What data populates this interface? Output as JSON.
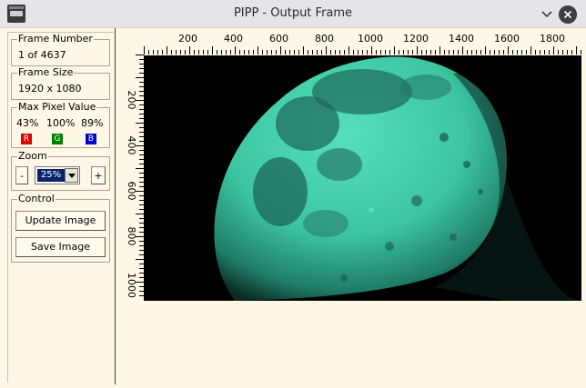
{
  "window": {
    "title": "PIPP - Output Frame"
  },
  "frame_number": {
    "label": "Frame Number",
    "value": "1 of 4637"
  },
  "frame_size": {
    "label": "Frame Size",
    "value": "1920 x 1080"
  },
  "max_pixel": {
    "label": "Max Pixel Value",
    "r_value": "43%",
    "g_value": "100%",
    "b_value": "89%",
    "r_label": "R",
    "g_label": "G",
    "b_label": "B",
    "r_color": "#e00000",
    "g_color": "#008000",
    "b_color": "#0000d0"
  },
  "zoom": {
    "label": "Zoom",
    "minus_label": "-",
    "plus_label": "+",
    "value": "25%"
  },
  "control": {
    "label": "Control",
    "update_label": "Update Image",
    "save_label": "Save Image"
  },
  "ruler": {
    "x_labels": [
      "200",
      "400",
      "600",
      "800",
      "1000",
      "1200",
      "1400",
      "1600",
      "1800"
    ],
    "y_labels": [
      "200",
      "400",
      "600",
      "800",
      "1000"
    ]
  },
  "image": {
    "subject": "moon",
    "tint_color": "#3cc5a0"
  },
  "icons": {
    "app": "pipp-app-icon",
    "minimize": "chevron-down-icon",
    "close": "close-icon"
  }
}
